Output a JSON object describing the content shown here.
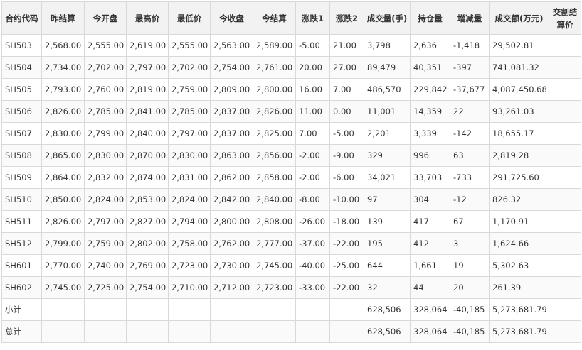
{
  "headers": [
    "合约代码",
    "昨结算",
    "今开盘",
    "最高价",
    "最低价",
    "今收盘",
    "今结算",
    "涨跌1",
    "涨跌2",
    "成交量(手)",
    "持仓量",
    "增减量",
    "成交额(万元)",
    "交割结算价"
  ],
  "rows": [
    [
      "SH503",
      "2,568.00",
      "2,555.00",
      "2,619.00",
      "2,555.00",
      "2,563.00",
      "2,589.00",
      "-5.00",
      "21.00",
      "3,798",
      "2,636",
      "-1,418",
      "29,502.81",
      ""
    ],
    [
      "SH504",
      "2,734.00",
      "2,702.00",
      "2,797.00",
      "2,702.00",
      "2,754.00",
      "2,761.00",
      "20.00",
      "27.00",
      "89,479",
      "40,351",
      "-397",
      "741,081.32",
      ""
    ],
    [
      "SH505",
      "2,793.00",
      "2,760.00",
      "2,819.00",
      "2,759.00",
      "2,809.00",
      "2,800.00",
      "16.00",
      "7.00",
      "486,570",
      "229,842",
      "-37,677",
      "4,087,450.68",
      ""
    ],
    [
      "SH506",
      "2,826.00",
      "2,785.00",
      "2,841.00",
      "2,785.00",
      "2,837.00",
      "2,826.00",
      "11.00",
      "0.00",
      "11,001",
      "14,359",
      "22",
      "93,261.03",
      ""
    ],
    [
      "SH507",
      "2,830.00",
      "2,799.00",
      "2,840.00",
      "2,797.00",
      "2,837.00",
      "2,825.00",
      "7.00",
      "-5.00",
      "2,201",
      "3,339",
      "-142",
      "18,655.17",
      ""
    ],
    [
      "SH508",
      "2,865.00",
      "2,830.00",
      "2,870.00",
      "2,830.00",
      "2,863.00",
      "2,856.00",
      "-2.00",
      "-9.00",
      "329",
      "996",
      "63",
      "2,819.28",
      ""
    ],
    [
      "SH509",
      "2,864.00",
      "2,832.00",
      "2,874.00",
      "2,831.00",
      "2,862.00",
      "2,858.00",
      "-2.00",
      "-6.00",
      "34,021",
      "33,703",
      "-733",
      "291,725.60",
      ""
    ],
    [
      "SH510",
      "2,850.00",
      "2,824.00",
      "2,853.00",
      "2,824.00",
      "2,842.00",
      "2,840.00",
      "-8.00",
      "-10.00",
      "97",
      "304",
      "-12",
      "826.32",
      ""
    ],
    [
      "SH511",
      "2,826.00",
      "2,797.00",
      "2,827.00",
      "2,794.00",
      "2,800.00",
      "2,808.00",
      "-26.00",
      "-18.00",
      "139",
      "417",
      "67",
      "1,170.91",
      ""
    ],
    [
      "SH512",
      "2,799.00",
      "2,759.00",
      "2,802.00",
      "2,758.00",
      "2,762.00",
      "2,777.00",
      "-37.00",
      "-22.00",
      "195",
      "412",
      "3",
      "1,624.66",
      ""
    ],
    [
      "SH601",
      "2,770.00",
      "2,740.00",
      "2,769.00",
      "2,723.00",
      "2,730.00",
      "2,745.00",
      "-40.00",
      "-25.00",
      "644",
      "1,661",
      "19",
      "5,302.63",
      ""
    ],
    [
      "SH602",
      "2,745.00",
      "2,725.00",
      "2,754.00",
      "2,710.00",
      "2,712.00",
      "2,723.00",
      "-33.00",
      "-22.00",
      "32",
      "44",
      "20",
      "261.39",
      ""
    ],
    [
      "小计",
      "",
      "",
      "",
      "",
      "",
      "",
      "",
      "",
      "628,506",
      "328,064",
      "-40,185",
      "5,273,681.79",
      ""
    ],
    [
      "总计",
      "",
      "",
      "",
      "",
      "",
      "",
      "",
      "",
      "628,506",
      "328,064",
      "-40,185",
      "5,273,681.79",
      ""
    ]
  ]
}
